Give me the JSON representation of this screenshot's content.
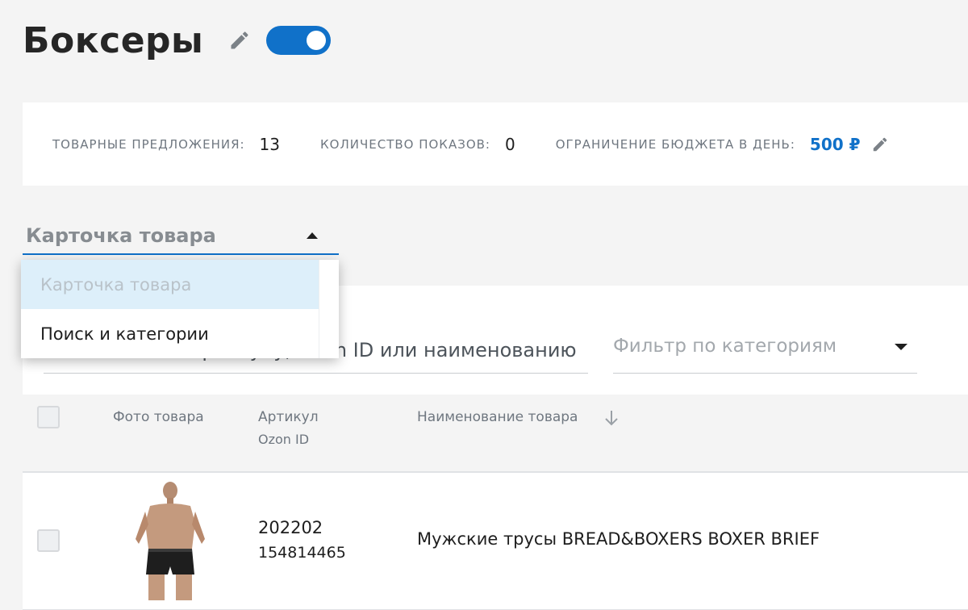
{
  "header": {
    "title": "Боксеры",
    "edit_icon": "pencil-icon",
    "toggle_state": "on",
    "accent_color": "#1071c9"
  },
  "stats": {
    "offers_label": "ТОВАРНЫЕ ПРЕДЛОЖЕНИЯ:",
    "offers_value": "13",
    "impressions_label": "КОЛИЧЕСТВО ПОКАЗОВ:",
    "impressions_value": "0",
    "budget_label": "ОГРАНИЧЕНИЕ БЮДЖЕТА В ДЕНЬ:",
    "budget_value": "500 ₽"
  },
  "placement_select": {
    "selected": "Карточка товара",
    "options": [
      "Карточка товара",
      "Поиск и категории"
    ]
  },
  "filters": {
    "search_placeholder": "Поиск по артикулу, Ozon ID или наименованию",
    "category_placeholder": "Фильтр по категориям"
  },
  "table": {
    "columns": {
      "photo": "Фото товара",
      "sku": "Артикул",
      "ozon_id": "Ozon ID",
      "name": "Наименование товара"
    },
    "rows": [
      {
        "sku": "202202",
        "ozon_id": "154814465",
        "name": "Мужские трусы BREAD&BOXERS BOXER BRIEF"
      }
    ]
  }
}
